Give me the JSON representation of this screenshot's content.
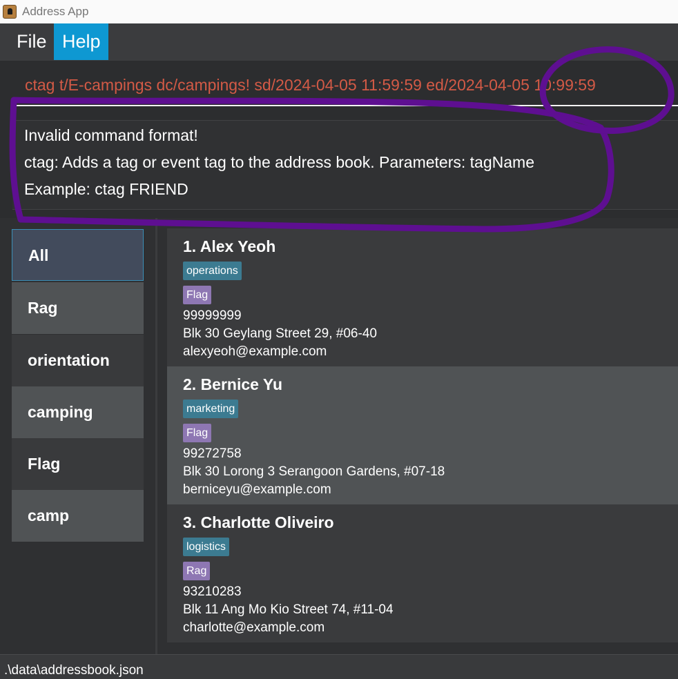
{
  "window": {
    "title": "Address App"
  },
  "menu": {
    "file": "File",
    "help": "Help"
  },
  "command": {
    "text": "ctag t/E-campings dc/campings! sd/2024-04-05 11:59:59 ed/2024-04-05 10:99:59"
  },
  "result": {
    "line1": "Invalid command format!",
    "line2": "ctag: Adds a tag or event tag to the address book. Parameters: tagName",
    "line3": "Example: ctag FRIEND"
  },
  "tags": [
    {
      "label": "All"
    },
    {
      "label": "Rag"
    },
    {
      "label": "orientation"
    },
    {
      "label": "camping"
    },
    {
      "label": "Flag"
    },
    {
      "label": "camp"
    }
  ],
  "persons": [
    {
      "name": "1.  Alex Yeoh",
      "role": "operations",
      "event": "Flag",
      "phone": "99999999",
      "address": "Blk 30 Geylang Street 29, #06-40",
      "email": "alexyeoh@example.com"
    },
    {
      "name": "2.  Bernice Yu",
      "role": "marketing",
      "event": "Flag",
      "phone": "99272758",
      "address": "Blk 30 Lorong 3 Serangoon Gardens, #07-18",
      "email": "berniceyu@example.com"
    },
    {
      "name": "3.  Charlotte Oliveiro",
      "role": "logistics",
      "event": "Rag",
      "phone": "93210283",
      "address": "Blk 11 Ang Mo Kio Street 74, #11-04",
      "email": "charlotte@example.com"
    }
  ],
  "status": {
    "path": ".\\data\\addressbook.json"
  },
  "colors": {
    "accent": "#0e98d2",
    "error_text": "#d35a46",
    "role_badge": "#3c7b91",
    "event_badge": "#8e77b3",
    "annotation_stroke": "#5e0f91"
  },
  "icons": {
    "app": "address-book-icon"
  }
}
